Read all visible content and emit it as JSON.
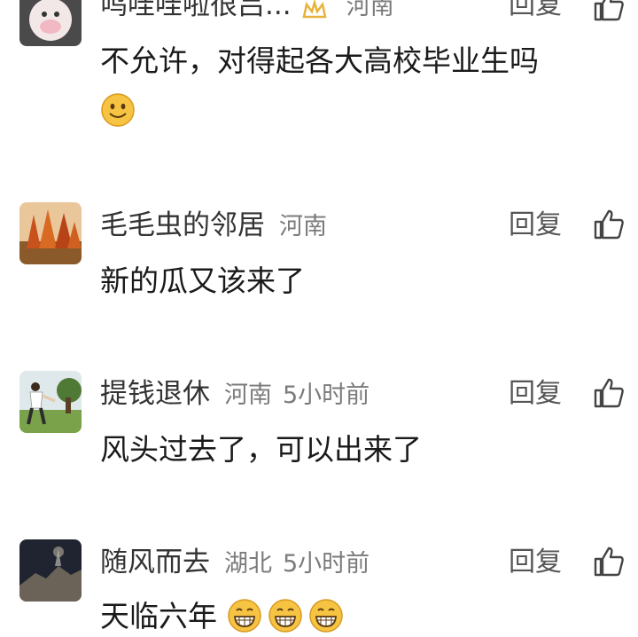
{
  "comments": [
    {
      "author": "呜哇哇啦很吕...",
      "location": "河南",
      "time": "",
      "reply_label": "回复",
      "text": "不允许，对得起各大高校毕业生吗",
      "emojis": [
        "smile"
      ]
    },
    {
      "author": "毛毛虫的邻居",
      "location": "河南",
      "time": "",
      "reply_label": "回复",
      "text": "新的瓜又该来了",
      "emojis": []
    },
    {
      "author": "提钱退休",
      "location": "河南",
      "time": "5小时前",
      "reply_label": "回复",
      "text": "风头过去了，可以出来了",
      "emojis": []
    },
    {
      "author": "随风而去",
      "location": "湖北",
      "time": "5小时前",
      "reply_label": "回复",
      "text": "天临六年",
      "emojis": [
        "grin",
        "grin",
        "grin"
      ]
    }
  ],
  "icons": {
    "like": "thumbs-up-icon",
    "vip_badge": "crown-badge-icon"
  },
  "colors": {
    "meta_text": "#7b7b7b",
    "emoji_yellow": "#f6c343"
  }
}
